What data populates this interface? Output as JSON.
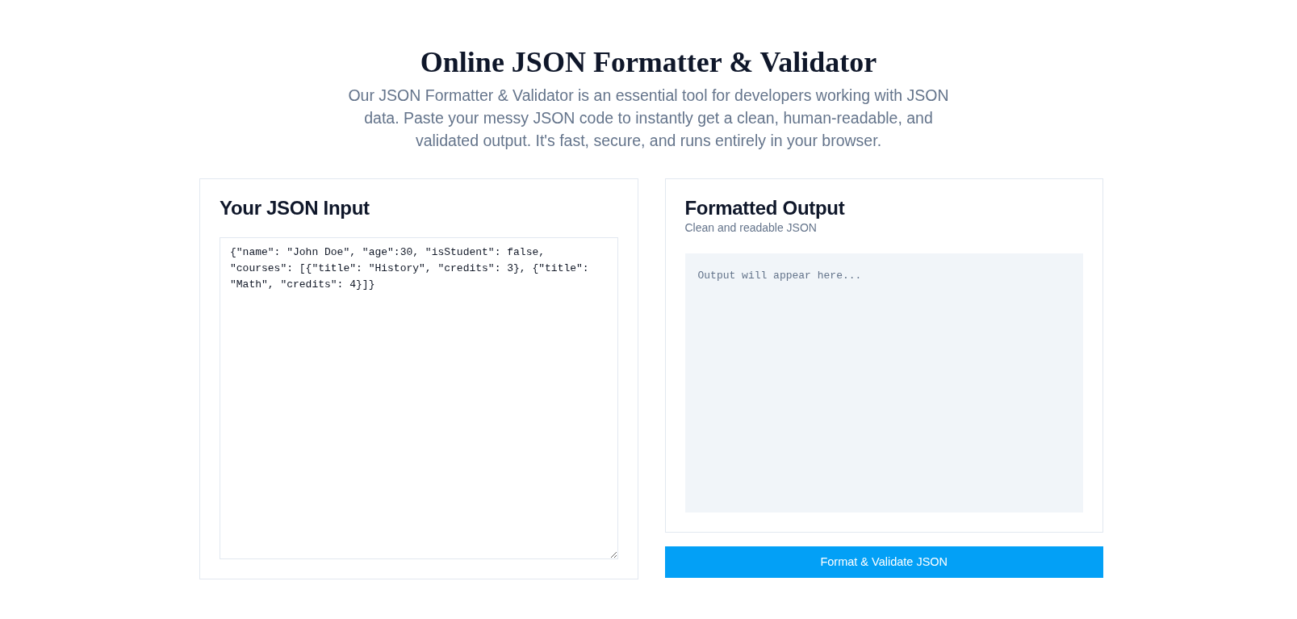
{
  "header": {
    "title": "Online JSON Formatter & Validator",
    "description": "Our JSON Formatter & Validator is an essential tool for developers working with JSON data. Paste your messy JSON code to instantly get a clean, human-readable, and validated output. It's fast, secure, and runs entirely in your browser."
  },
  "input_card": {
    "title": "Your JSON Input",
    "input": {
      "value": "{\"name\": \"John Doe\", \"age\":30, \"isStudent\": false, \"courses\": [{\"title\": \"History\", \"credits\": 3}, {\"title\": \"Math\", \"credits\": 4}]}"
    }
  },
  "output_card": {
    "title": "Formatted Output",
    "subtitle": "Clean and readable JSON",
    "output": {
      "placeholder": "Output will appear here..."
    }
  },
  "button": {
    "label": "Format & Validate JSON"
  }
}
